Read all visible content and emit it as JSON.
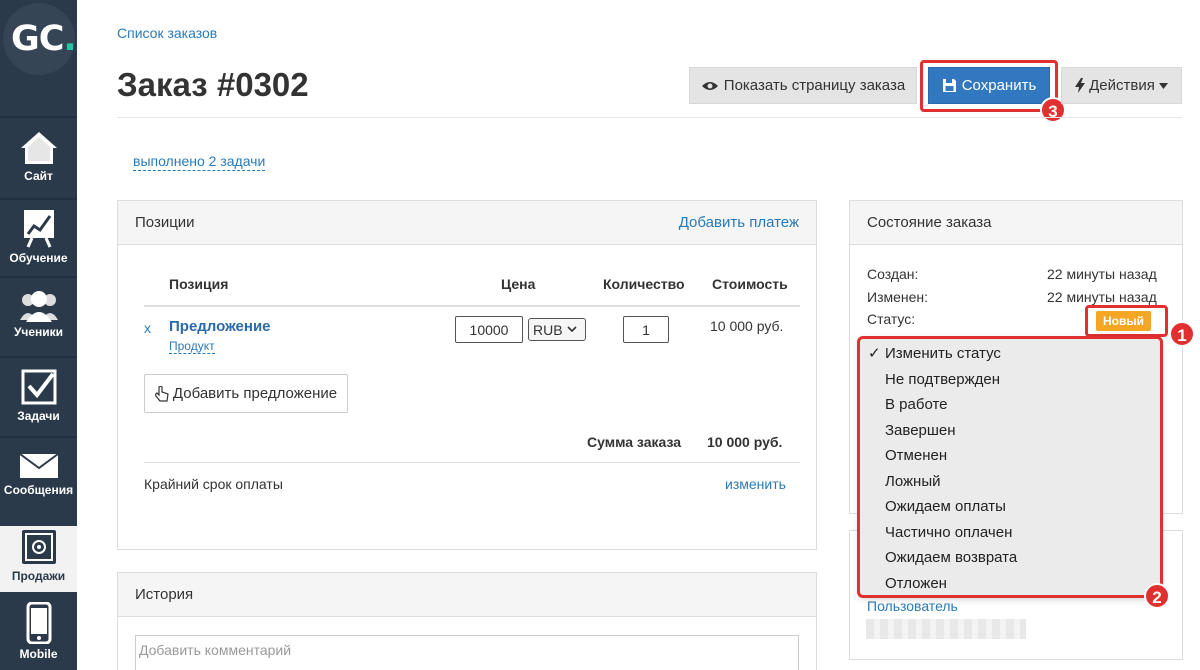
{
  "sidebar": {
    "logo": {
      "text": "GC",
      "dot": "."
    },
    "items": [
      {
        "label": "Сайт",
        "icon": "house-icon"
      },
      {
        "label": "Обучение",
        "icon": "chart-board-icon"
      },
      {
        "label": "Ученики",
        "icon": "users-icon"
      },
      {
        "label": "Задачи",
        "icon": "checkbox-icon"
      },
      {
        "label": "Сообщения",
        "icon": "envelope-icon"
      },
      {
        "label": "Продажи",
        "icon": "safe-icon"
      },
      {
        "label": "Mobile",
        "icon": "phone-icon"
      }
    ]
  },
  "header": {
    "breadcrumb": "Список заказов",
    "title": "Заказ #0302",
    "view_button": "Показать страницу заказа",
    "save_button": "Сохранить",
    "actions_button": "Действия",
    "tasks_link": "выполнено 2 задачи"
  },
  "callouts": {
    "one": "1",
    "two": "2",
    "three": "3"
  },
  "positions": {
    "title": "Позиции",
    "add_payment": "Добавить платеж",
    "columns": {
      "item": "Позиция",
      "price": "Цена",
      "quantity": "Количество",
      "cost": "Стоимость"
    },
    "row": {
      "remove": "x",
      "name": "Предложение",
      "type": "Продукт",
      "price": "10000",
      "currency": "RUB",
      "quantity": "1",
      "cost": "10 000 руб."
    },
    "add_offer": "Добавить предложение",
    "total_label": "Сумма заказа",
    "total_value": "10 000 руб.",
    "deadline_label": "Крайний срок оплаты",
    "deadline_change": "изменить"
  },
  "status_panel": {
    "title": "Состояние заказа",
    "created_label": "Создан:",
    "created_value": "22 минуты назад",
    "modified_label": "Изменен:",
    "modified_value": "22 минуты назад",
    "status_label": "Статус:",
    "status_value": "Новый",
    "status_color": "#f5a623"
  },
  "status_dropdown": {
    "options": [
      {
        "label": "Изменить статус",
        "checked": true
      },
      {
        "label": "Не подтвержден",
        "checked": false
      },
      {
        "label": "В работе",
        "checked": false
      },
      {
        "label": "Завершен",
        "checked": false
      },
      {
        "label": "Отменен",
        "checked": false
      },
      {
        "label": "Ложный",
        "checked": false
      },
      {
        "label": "Ожидаем оплаты",
        "checked": false
      },
      {
        "label": "Частично оплачен",
        "checked": false
      },
      {
        "label": "Ожидаем возврата",
        "checked": false
      },
      {
        "label": "Отложен",
        "checked": false
      }
    ],
    "check_mark": "✓"
  },
  "user_panel": {
    "user_link": "Пользователь"
  },
  "history": {
    "title": "История",
    "comment_placeholder": "Добавить комментарий"
  },
  "colors": {
    "accent": "#3278c1",
    "link": "#2a7ab7",
    "highlight": "#e03030",
    "sidebar": "#2b3a4a"
  }
}
